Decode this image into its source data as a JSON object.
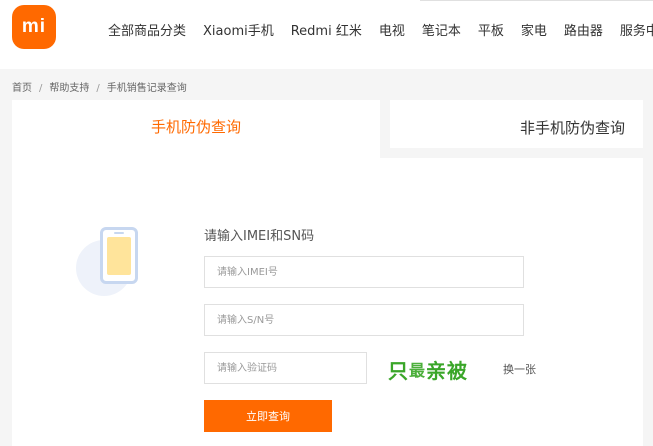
{
  "header": {
    "logo_text": "mi",
    "nav": [
      "全部商品分类",
      "Xiaomi手机",
      "Redmi 红米",
      "电视",
      "笔记本",
      "平板",
      "家电",
      "路由器",
      "服务中心"
    ]
  },
  "breadcrumb": [
    "首页",
    "帮助支持",
    "手机销售记录查询"
  ],
  "breadcrumb_separator": "/",
  "tabs": {
    "phone": "手机防伪查询",
    "non_phone": "非手机防伪查询"
  },
  "form": {
    "title": "请输入IMEI和SN码",
    "imei_placeholder": "请输入IMEI号",
    "sn_placeholder": "请输入S/N号",
    "code_placeholder": "请输入验证码",
    "captcha_chars": [
      "只",
      "最",
      "亲",
      "被"
    ],
    "refresh_label": "换一张",
    "submit_label": "立即查询"
  },
  "colors": {
    "brand": "#ff6900",
    "captcha": "#3aa629"
  }
}
